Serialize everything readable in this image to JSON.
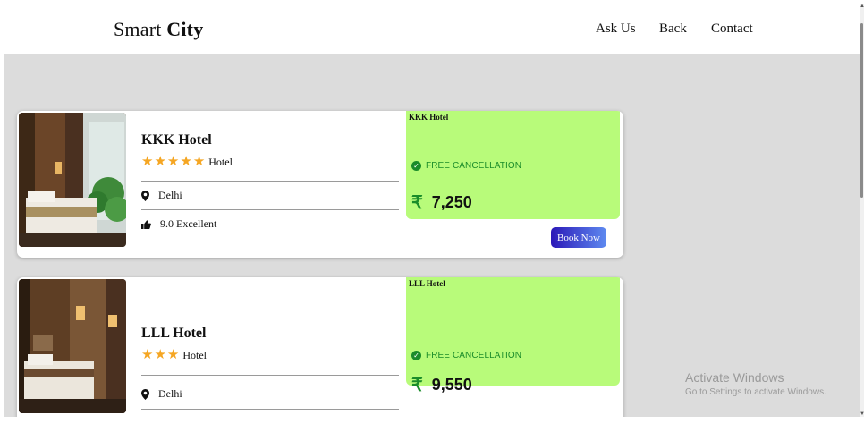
{
  "brand": {
    "part1": "Smart",
    "part2": "City"
  },
  "nav": {
    "links": [
      "Ask Us",
      "Back",
      "Contact"
    ]
  },
  "hotels": [
    {
      "name": "KKK Hotel",
      "stars": 5,
      "type": "Hotel",
      "location": "Delhi",
      "rating": "9.0 Excellent",
      "price_box_name": "KKK Hotel",
      "cancellation": "FREE CANCELLATION",
      "currency": "₹",
      "price": "7,250",
      "book_label": "Book Now"
    },
    {
      "name": "LLL Hotel",
      "stars": 3,
      "type": "Hotel",
      "location": "Delhi",
      "price_box_name": "LLL Hotel",
      "cancellation": "FREE CANCELLATION",
      "currency": "₹",
      "price": "9,550"
    }
  ],
  "watermark": {
    "title": "Activate Windows",
    "subtitle": "Go to Settings to activate Windows."
  },
  "colors": {
    "price_box": "#b8fb7a",
    "accent_green": "#1a8c2a",
    "star": "#f5a623",
    "button_start": "#2b18b8",
    "button_end": "#5e8af0",
    "page_bg": "#dcdcdc"
  }
}
